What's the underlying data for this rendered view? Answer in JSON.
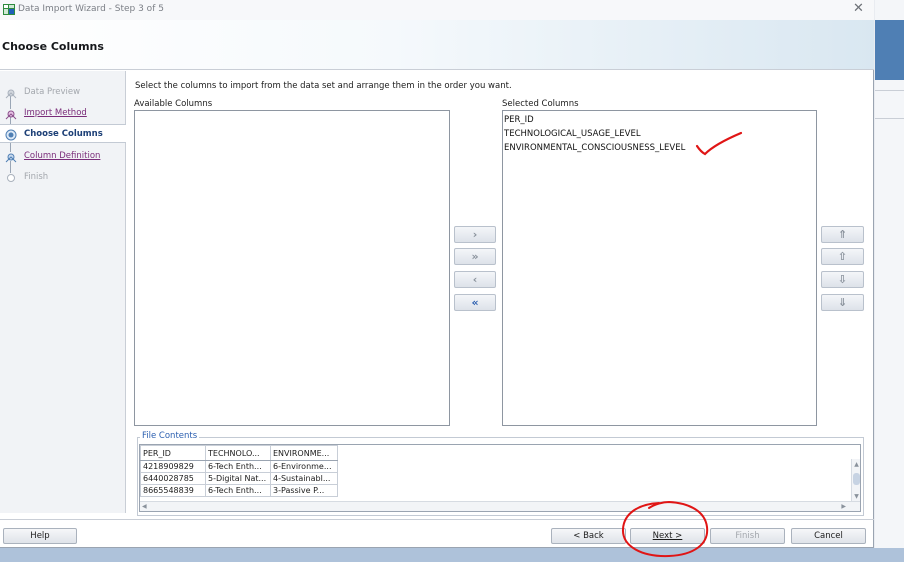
{
  "window": {
    "title": "Data Import Wizard - Step 3 of 5",
    "close_glyph": "✕"
  },
  "header": {
    "title": "Choose Columns"
  },
  "steps": [
    {
      "label": "Data Preview",
      "state": "disabled"
    },
    {
      "label": "Import Method",
      "state": "link"
    },
    {
      "label": "Choose Columns",
      "state": "active"
    },
    {
      "label": "Column Definition",
      "state": "link"
    },
    {
      "label": "Finish",
      "state": "disabled"
    }
  ],
  "main": {
    "instruction": "Select the columns to import from the data set and arrange them in the order you want.",
    "available_label": "Available Columns",
    "selected_label": "Selected Columns",
    "selected_columns": [
      "PER_ID",
      "TECHNOLOGICAL_USAGE_LEVEL",
      "ENVIRONMENTAL_CONSCIOUSNESS_LEVEL"
    ]
  },
  "move_buttons": {
    "add": "›",
    "add_all": "»",
    "remove": "‹",
    "remove_all": "«"
  },
  "order_buttons": {
    "top": "⇑",
    "up": "⇧",
    "down": "⇩",
    "bottom": "⇓"
  },
  "file_contents": {
    "legend": "File Contents",
    "headers": [
      "PER_ID",
      "TECHNOLO...",
      "ENVIRONME..."
    ],
    "rows": [
      [
        "4218909829",
        "6-Tech Enth...",
        "6-Environme..."
      ],
      [
        "6440028785",
        "5-Digital Nat...",
        "4-Sustainabl..."
      ],
      [
        "8665548839",
        "6-Tech Enth...",
        "3-Passive P..."
      ]
    ]
  },
  "buttons": {
    "help": "Help",
    "back": "< Back",
    "next": "Next >",
    "finish": "Finish",
    "cancel": "Cancel"
  },
  "colors": {
    "annotation": "#e01515",
    "link": "#7a2d7a",
    "active_step": "#1c3f76"
  }
}
